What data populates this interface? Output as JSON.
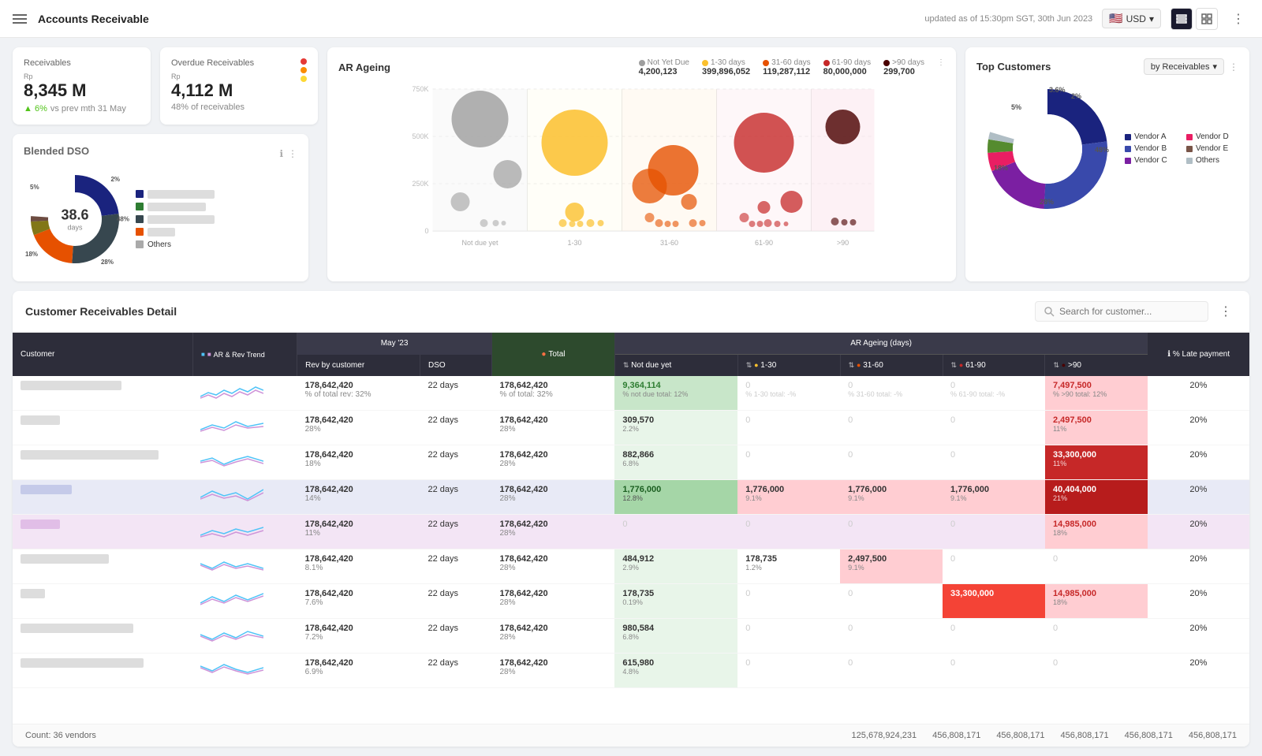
{
  "header": {
    "title": "Accounts Receivable",
    "timestamp": "updated as of 15:30pm SGT, 30th Jun 2023",
    "currency": "USD",
    "menu_icon": "≡"
  },
  "receivables": {
    "label": "Receivables",
    "currency_prefix": "Rp",
    "value": "8,345 M",
    "change_pct": "6%",
    "change_dir": "up",
    "change_label": "vs prev mth 31 May"
  },
  "overdue_receivables": {
    "label": "Overdue Receivables",
    "currency_prefix": "Rp",
    "value": "4,112 M",
    "sub_label": "48% of receivables",
    "indicators": [
      "#e53935",
      "#fb8c00",
      "#fdd835"
    ]
  },
  "blended_dso": {
    "title": "Blended DSO",
    "center_value": "38.6",
    "center_unit": "days",
    "segments": [
      {
        "label": "48%",
        "color": "#1a237e",
        "pct": 48
      },
      {
        "label": "28%",
        "color": "#37474f",
        "pct": 28
      },
      {
        "label": "18%",
        "color": "#e65100",
        "pct": 18
      },
      {
        "label": "5%",
        "color": "#827717",
        "pct": 5
      },
      {
        "label": "2%",
        "color": "#6d4c41",
        "pct": 2
      }
    ],
    "legend_items": [
      {
        "color": "#1a237e",
        "label": "████████████"
      },
      {
        "color": "#2e7d32",
        "label": "███████ ███"
      },
      {
        "color": "#37474f",
        "label": "████████████"
      },
      {
        "color": "#e65100",
        "label": "█████"
      },
      {
        "color": "#aaa",
        "label": "Others"
      }
    ]
  },
  "ar_ageing": {
    "title": "AR Ageing",
    "legend": [
      {
        "label": "Not Yet Due",
        "color": "#9e9e9e",
        "value": "4,200,123"
      },
      {
        "label": "1-30 days",
        "color": "#fbc02d",
        "value": "399,896,052"
      },
      {
        "label": "31-60 days",
        "color": "#e65100",
        "value": "119,287,112"
      },
      {
        "label": "61-90 days",
        "color": "#c62828",
        "value": "80,000,000"
      },
      {
        "label": ">90 days",
        "color": "#4a0000",
        "value": "299,700"
      }
    ],
    "y_labels": [
      "750K",
      "500K",
      "250K",
      "0"
    ],
    "x_labels": [
      "Not due yet",
      "1-30",
      "31-60",
      "61-90",
      ">90"
    ]
  },
  "top_customers": {
    "title": "Top Customers",
    "by_label": "by Receivables",
    "segments": [
      {
        "label": "Vendor A",
        "color": "#1a237e",
        "pct": 48
      },
      {
        "label": "Vendor B",
        "color": "#283593",
        "pct": 28
      },
      {
        "label": "Vendor C",
        "color": "#7b1fa2",
        "pct": 18
      },
      {
        "label": "Vendor D",
        "color": "#e91e63",
        "pct": 5
      },
      {
        "label": "Vendor E",
        "color": "#795548",
        "pct": 3.6
      },
      {
        "label": "Others",
        "color": "#b0bec5",
        "pct": 2
      }
    ],
    "pct_labels": [
      {
        "value": "48%",
        "right": true
      },
      {
        "value": "28%"
      },
      {
        "value": "18%"
      },
      {
        "value": "5%"
      },
      {
        "value": "3.6%"
      },
      {
        "value": "2%"
      }
    ]
  },
  "customer_detail": {
    "title": "Customer Receivables Detail",
    "search_placeholder": "Search for customer...",
    "columns": {
      "customer": "Customer",
      "ar_rev_trend": "AR & Rev Trend",
      "rev_by_customer": "Rev by customer",
      "dso": "DSO",
      "total": "Total",
      "not_due_yet": "Not due yet",
      "ar_1_30": "1-30",
      "ar_31_60": "31-60",
      "ar_61_90": "61-90",
      "ar_gt90": ">90",
      "late_payment": "% Late payment",
      "period": "May '23"
    },
    "rows": [
      {
        "name": "████ ████████████",
        "rev": "178,642,420",
        "rev_pct": "32%",
        "dso": "22 days",
        "total": "178,642,420",
        "total_pct": "32%",
        "not_due": "9,364,114",
        "not_due_sub": "% not due total: 12%",
        "not_due_color": "green",
        "d1_30": "",
        "d1_30_sub": "% 1-30 total: -%",
        "d31_60": "",
        "d31_60_sub": "% 31-60 total: -%",
        "d61_90": "",
        "d61_90_sub": "% 61-90 total: -%",
        "dgt90": "7,497,500",
        "dgt90_sub": "% >90 total: 12%",
        "dgt90_color": "light-red",
        "late_pct": "20%"
      },
      {
        "name": "████ ██",
        "rev": "178,642,420",
        "rev_pct": "28%",
        "dso": "22 days",
        "total": "178,642,420",
        "total_pct": "28%",
        "not_due": "309,570",
        "not_due_sub": "2.2%",
        "not_due_color": "light-green",
        "d1_30": "",
        "d31_60": "",
        "d61_90": "",
        "dgt90": "2,497,500",
        "dgt90_sub": "11%",
        "dgt90_color": "light-red",
        "late_pct": "20%"
      },
      {
        "name": "████ ██████████████████",
        "rev": "178,642,420",
        "rev_pct": "18%",
        "dso": "22 days",
        "total": "178,642,420",
        "total_pct": "28%",
        "not_due": "882,866",
        "not_due_sub": "6.8%",
        "not_due_color": "light-green",
        "d1_30": "",
        "d31_60": "",
        "d61_90": "",
        "dgt90": "33,300,000",
        "dgt90_sub": "11%",
        "dgt90_color": "dark-red",
        "late_pct": "20%"
      },
      {
        "name": "██ ██████",
        "rev": "178,642,420",
        "rev_pct": "14%",
        "dso": "22 days",
        "total": "178,642,420",
        "total_pct": "28%",
        "not_due": "1,776,000",
        "not_due_sub": "12.8%",
        "not_due_color": "green",
        "d1_30": "1,776,000",
        "d1_30_sub": "9.1%",
        "d1_30_color": "pink",
        "d31_60": "1,776,000",
        "d31_60_sub": "9.1%",
        "d31_60_color": "pink",
        "d61_90": "1,776,000",
        "d61_90_sub": "9.1%",
        "d61_90_color": "pink",
        "dgt90": "40,404,000",
        "dgt90_sub": "21%",
        "dgt90_color": "dark-red",
        "late_pct": "20%",
        "row_highlight": true
      },
      {
        "name": "██ ████",
        "rev": "178,642,420",
        "rev_pct": "11%",
        "dso": "22 days",
        "total": "178,642,420",
        "total_pct": "28%",
        "not_due": "0",
        "not_due_color": "none",
        "d1_30": "0",
        "d31_60": "0",
        "d61_90": "0",
        "dgt90": "14,985,000",
        "dgt90_sub": "18%",
        "dgt90_color": "light-red",
        "late_pct": "20%",
        "row_highlight": true
      },
      {
        "name": "████ ██████████",
        "rev": "178,642,420",
        "rev_pct": "8.1%",
        "dso": "22 days",
        "total": "178,642,420",
        "total_pct": "28%",
        "not_due": "484,912",
        "not_due_sub": "2.9%",
        "not_due_color": "light-green",
        "d1_30": "178,735",
        "d1_30_sub": "1.2%",
        "d31_60": "2,497,500",
        "d31_60_sub": "9.1%",
        "d31_60_color": "pink",
        "d61_90": "0",
        "dgt90": "0",
        "late_pct": "20%"
      },
      {
        "name": "████",
        "rev": "178,642,420",
        "rev_pct": "7.6%",
        "dso": "22 days",
        "total": "178,642,420",
        "total_pct": "28%",
        "not_due": "178,735",
        "not_due_sub": "0.19%",
        "not_due_color": "light-green",
        "d1_30": "0",
        "d31_60": "0",
        "d61_90": "33,300,000",
        "d61_90_color": "red",
        "dgt90": "14,985,000",
        "dgt90_sub": "18%",
        "dgt90_color": "light-red",
        "late_pct": "20%"
      },
      {
        "name": "██ ████████████████",
        "rev": "178,642,420",
        "rev_pct": "7.2%",
        "dso": "22 days",
        "total": "178,642,420",
        "total_pct": "28%",
        "not_due": "980,584",
        "not_due_sub": "6.8%",
        "not_due_color": "light-green",
        "d1_30": "0",
        "d31_60": "0",
        "d61_90": "0",
        "dgt90": "0",
        "late_pct": "20%"
      },
      {
        "name": "████████████████████",
        "rev": "178,642,420",
        "rev_pct": "6.9%",
        "dso": "22 days",
        "total": "178,642,420",
        "total_pct": "28%",
        "not_due": "615,980",
        "not_due_sub": "4.8%",
        "not_due_color": "light-green",
        "d1_30": "0",
        "d31_60": "0",
        "d61_90": "0",
        "dgt90": "0",
        "late_pct": "20%"
      }
    ],
    "footer_count": "Count: 36 vendors",
    "footer_totals": {
      "total": "125,678,924,231",
      "not_due": "456,808,171",
      "d1_30": "456,808,171",
      "d31_60": "456,808,171",
      "d61_90": "456,808,171",
      "dgt90": "456,808,171"
    }
  }
}
